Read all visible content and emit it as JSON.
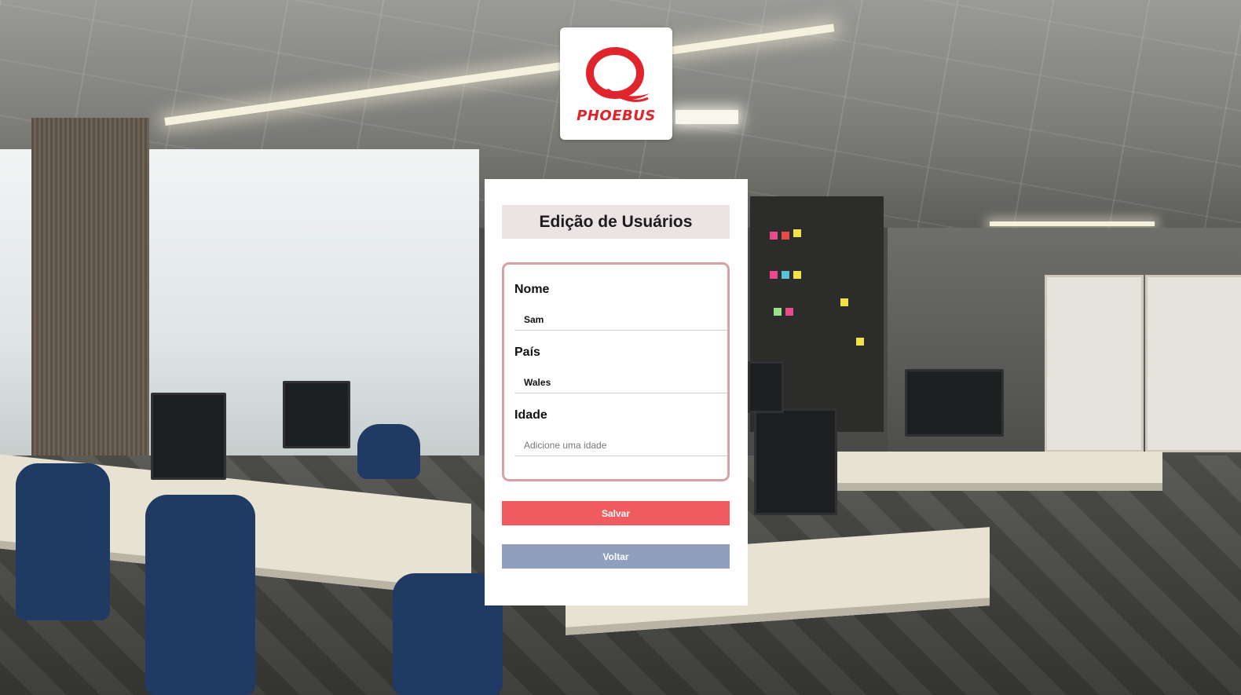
{
  "brand": {
    "name": "PHOEBUS",
    "logo_icon": "phoebus-logo-icon",
    "color": "#e0242c"
  },
  "page": {
    "title": "Edição de Usuários"
  },
  "form": {
    "name": {
      "label": "Nome",
      "value": "Sam",
      "placeholder": ""
    },
    "country": {
      "label": "País",
      "value": "Wales",
      "placeholder": ""
    },
    "age": {
      "label": "Idade",
      "value": "",
      "placeholder": "Adicione uma idade"
    }
  },
  "actions": {
    "save_label": "Salvar",
    "save_color": "#ef5b5e",
    "back_label": "Voltar",
    "back_color": "#8ea0bc"
  }
}
